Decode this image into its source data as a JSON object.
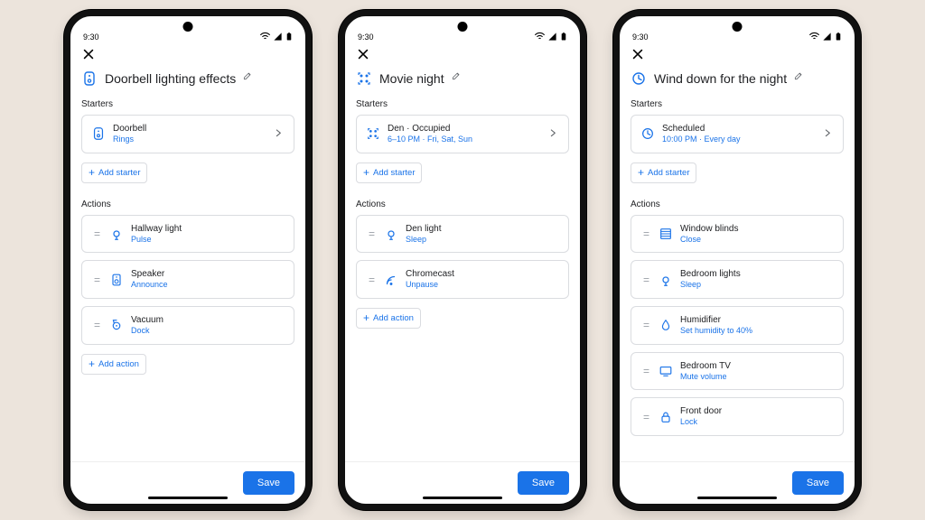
{
  "statusbar": {
    "time": "9:30"
  },
  "ui": {
    "starters_label": "Starters",
    "actions_label": "Actions",
    "add_starter": "Add starter",
    "add_action": "Add action",
    "save": "Save"
  },
  "phones": [
    {
      "title": "Doorbell lighting effects",
      "title_icon": "doorbell",
      "starters": [
        {
          "icon": "doorbell",
          "l1": "Doorbell",
          "l2": "Rings",
          "chevron": true
        }
      ],
      "actions": [
        {
          "icon": "light",
          "l1": "Hallway light",
          "l2": "Pulse"
        },
        {
          "icon": "speaker",
          "l1": "Speaker",
          "l2": "Announce"
        },
        {
          "icon": "vacuum",
          "l1": "Vacuum",
          "l2": "Dock"
        }
      ]
    },
    {
      "title": "Movie night",
      "title_icon": "together",
      "starters": [
        {
          "icon": "together",
          "l1": "Den · Occupied",
          "l2": "6–10 PM · Fri, Sat, Sun",
          "chevron": true
        }
      ],
      "actions": [
        {
          "icon": "light",
          "l1": "Den light",
          "l2": "Sleep"
        },
        {
          "icon": "cast",
          "l1": "Chromecast",
          "l2": "Unpause"
        }
      ]
    },
    {
      "title": "Wind down for the night",
      "title_icon": "clock",
      "starters": [
        {
          "icon": "clock",
          "l1": "Scheduled",
          "l2": "10:00 PM · Every day",
          "chevron": true
        }
      ],
      "actions": [
        {
          "icon": "blinds",
          "l1": "Window blinds",
          "l2": "Close"
        },
        {
          "icon": "light",
          "l1": "Bedroom lights",
          "l2": "Sleep"
        },
        {
          "icon": "humidifier",
          "l1": "Humidifier",
          "l2": "Set humidity to 40%"
        },
        {
          "icon": "tv",
          "l1": "Bedroom TV",
          "l2": "Mute volume"
        },
        {
          "icon": "lock",
          "l1": "Front door",
          "l2": "Lock"
        }
      ],
      "fade_last": true
    }
  ]
}
